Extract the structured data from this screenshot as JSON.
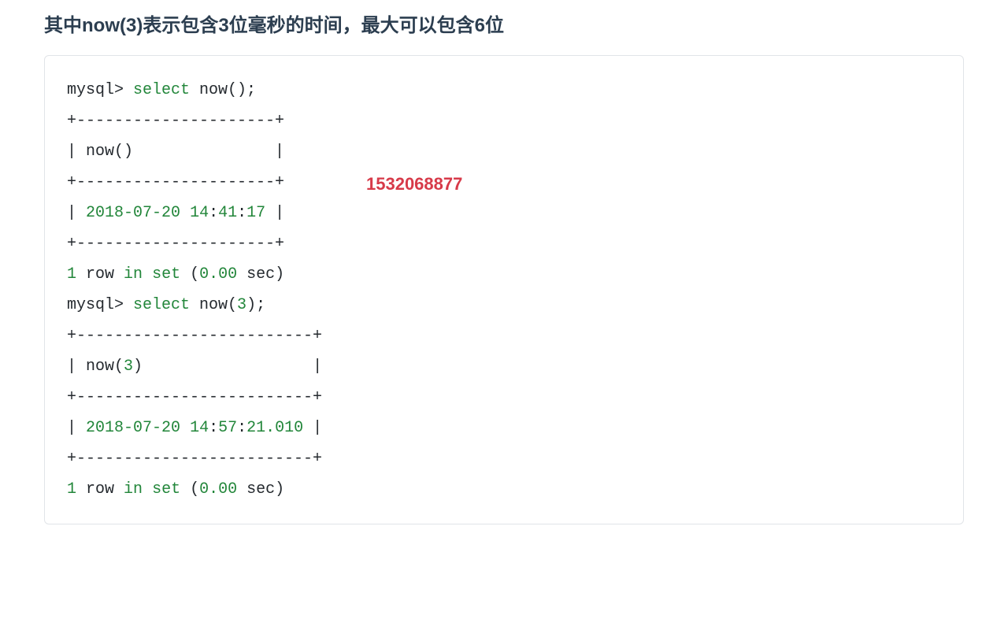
{
  "heading": "其中now(3)表示包含3位毫秒的时间，最大可以包含6位",
  "annotation": "1532068877",
  "code": {
    "q1_prompt": "mysql> ",
    "q1_select": "select",
    "q1_rest": " now();",
    "border1": "+---------------------+",
    "header1_a": "| now()               |",
    "border1b": "+---------------------+",
    "row1_pipe1": "| ",
    "row1_year": "2018-07-20",
    "row1_sp1": " ",
    "row1_time": "14",
    "row1_colon1": ":",
    "row1_min": "41",
    "row1_colon2": ":",
    "row1_sec": "17",
    "row1_pipe2": " |",
    "border1c": "+---------------------+",
    "result1_a": "1",
    "result1_b": " row ",
    "result1_in": "in",
    "result1_c": " ",
    "result1_set": "set",
    "result1_d": " (",
    "result1_num": "0.00",
    "result1_e": " sec)",
    "blank": "",
    "q2_prompt": "mysql> ",
    "q2_select": "select",
    "q2_rest_a": " now(",
    "q2_arg": "3",
    "q2_rest_b": ");",
    "border2": "+-------------------------+",
    "header2_a": "| now(",
    "header2_arg": "3",
    "header2_b": ")                  |",
    "border2b": "+-------------------------+",
    "row2_pipe1": "| ",
    "row2_year": "2018-07-20",
    "row2_sp1": " ",
    "row2_h": "14",
    "row2_c1": ":",
    "row2_m": "57",
    "row2_c2": ":",
    "row2_s": "21.010",
    "row2_pipe2": " |",
    "border2c": "+-------------------------+",
    "result2_a": "1",
    "result2_b": " row ",
    "result2_in": "in",
    "result2_c": " ",
    "result2_set": "set",
    "result2_d": " (",
    "result2_num": "0.00",
    "result2_e": " sec)"
  }
}
